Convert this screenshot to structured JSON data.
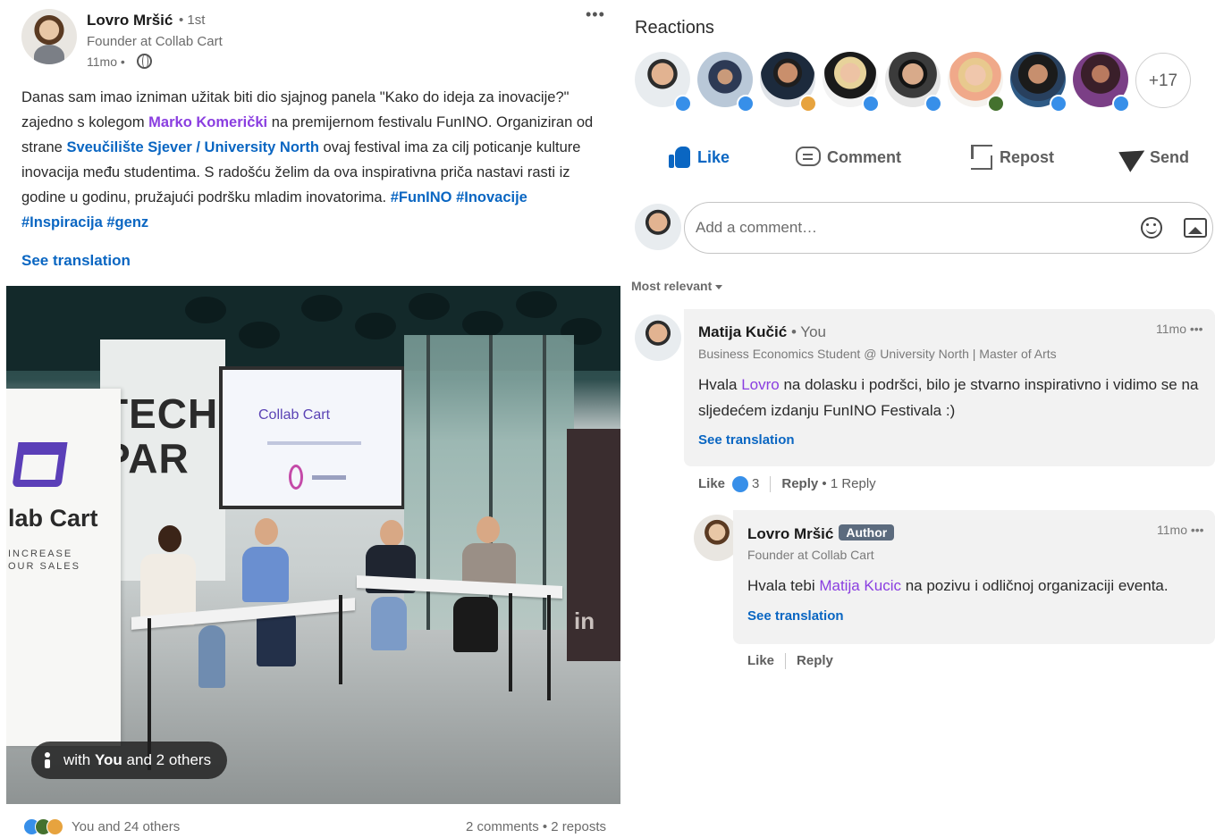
{
  "post": {
    "author_name": "Lovro Mršić",
    "degree": "• 1st",
    "headline": "Founder at Collab Cart",
    "time": "11mo •",
    "menu": "•••",
    "body_parts": [
      "Danas sam imao izniman užitak biti dio sjajnog panela \"Kako do ideja za inovacije?\" zajedno s kolegom ",
      "Marko Komerički",
      " na premijernom festivalu FunINO. Organiziran od strane ",
      "Sveučilište Sjever / University North",
      " ovaj festival ima za cilj poticanje kulture inovacija među studentima. S radošću želim da ova inspirativna priča nastavi rasti iz godine u godinu, pružajući podršku mladim inovatorima. ",
      "#FunINO #Inovacije #Inspiracija #genz"
    ],
    "see_translation": "See translation",
    "image": {
      "wall_text_line1": "TECH",
      "wall_text_line2": "PAR",
      "screen_logo": "Collab Cart",
      "rollup_brand": "lab Cart",
      "rollup_tag_line1": "INCREASE",
      "rollup_tag_line2": "OUR SALES",
      "rollup_right_text": "in"
    },
    "tag_pill_prefix": "with ",
    "tag_pill_you": "You",
    "tag_pill_suffix": " and 2 others",
    "social_reactions": "You and 24 others",
    "social_counts": "2 comments • 2 reposts"
  },
  "reactions": {
    "title": "Reactions",
    "more": "+17",
    "actions": {
      "like": "Like",
      "comment": "Comment",
      "repost": "Repost",
      "send": "Send"
    },
    "accent": "#0a66c2"
  },
  "comment_box": {
    "placeholder": "Add a comment…",
    "sort": "Most relevant"
  },
  "comments": [
    {
      "name": "Matija Kučić",
      "you_label": "• You",
      "headline": "Business Economics Student @ University North | Master of Arts",
      "time": "11mo •••",
      "text_parts": [
        "Hvala ",
        "Lovro",
        " na dolasku i podršci, bilo je stvarno inspirativno i vidimo se na sljedećem izdanju FunINO Festivala :)"
      ],
      "see_translation": "See translation",
      "like": "Like",
      "like_count": "3",
      "reply": "Reply",
      "replies": "1 Reply"
    },
    {
      "name": "Lovro Mršić",
      "badge": "Author",
      "headline": "Founder at Collab Cart",
      "time": "11mo •••",
      "text_parts": [
        "Hvala tebi ",
        "Matija Kucic",
        " na pozivu i odličnoj organizaciji eventa."
      ],
      "see_translation": "See translation",
      "like": "Like",
      "reply": "Reply"
    }
  ]
}
